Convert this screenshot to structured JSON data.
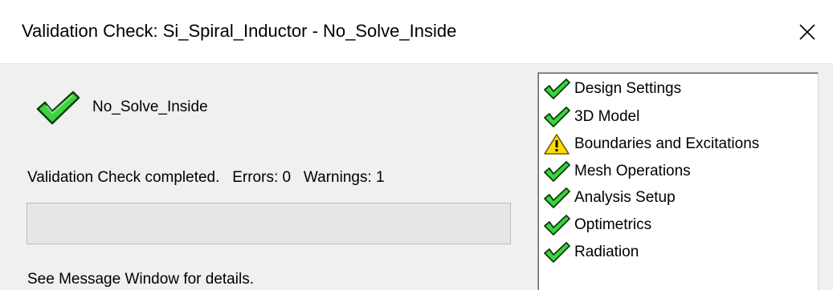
{
  "window": {
    "title": "Validation Check: Si_Spiral_Inductor - No_Solve_Inside"
  },
  "design": {
    "name": "No_Solve_Inside",
    "status_icon": "green-check-icon"
  },
  "status": {
    "text": "Validation Check completed.   Errors: 0   Warnings: 1",
    "errors": 0,
    "warnings": 1
  },
  "progress": {
    "value": 0
  },
  "details": {
    "text": "See Message Window for details."
  },
  "checklist": {
    "items": [
      {
        "label": "Design Settings",
        "status": "ok",
        "icon": "green-check-icon"
      },
      {
        "label": "3D Model",
        "status": "ok",
        "icon": "green-check-icon"
      },
      {
        "label": "Boundaries and Excitations",
        "status": "warning",
        "icon": "warning-triangle-icon"
      },
      {
        "label": "Mesh Operations",
        "status": "ok",
        "icon": "green-check-icon"
      },
      {
        "label": "Analysis Setup",
        "status": "ok",
        "icon": "green-check-icon"
      },
      {
        "label": "Optimetrics",
        "status": "ok",
        "icon": "green-check-icon"
      },
      {
        "label": "Radiation",
        "status": "ok",
        "icon": "green-check-icon"
      }
    ]
  },
  "colors": {
    "check_fill": "#3cd43c",
    "check_outline": "#0b3d0b",
    "warning_fill": "#ffdd00",
    "warning_outline": "#6b5a00",
    "dialog_bg": "#f0f0f0"
  }
}
